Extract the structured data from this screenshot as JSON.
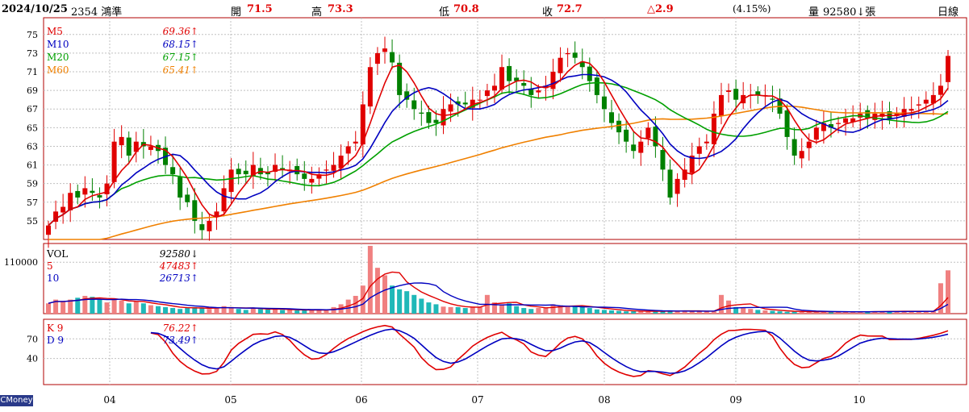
{
  "header": {
    "date": "2024/10/25",
    "stock": "2354 鴻準",
    "open_label": "開",
    "open": "71.5",
    "high_label": "高",
    "high": "73.3",
    "low_label": "低",
    "low": "70.8",
    "close_label": "收",
    "close": "72.7",
    "change": "△2.9",
    "pct": "(4.15%)",
    "volume_label": "量",
    "volume": "92580↓張",
    "period": "日線"
  },
  "brand": "CMoney",
  "colors": {
    "up": "#e00000",
    "down": "#008000",
    "ma5": "#e00000",
    "ma10": "#0000c0",
    "ma20": "#00a000",
    "ma60": "#f08000",
    "vol_up": "#f08080",
    "vol_down": "#20b8b8",
    "grid": "#c0c0c0"
  },
  "chart_data": [
    {
      "type": "candlestick",
      "panel": "price",
      "y_ticks": [
        55,
        57,
        59,
        61,
        63,
        65,
        67,
        69,
        71,
        73,
        75
      ],
      "ylim": [
        53,
        76.8
      ],
      "x_tick_labels": [
        "04",
        "05",
        "06",
        "07",
        "08",
        "09",
        "10"
      ],
      "legend": [
        {
          "name": "M5",
          "value": "69.36",
          "arrow": "↑",
          "color": "#e00000"
        },
        {
          "name": "M10",
          "value": "68.15",
          "arrow": "↑",
          "color": "#0000c0"
        },
        {
          "name": "M20",
          "value": "67.15",
          "arrow": "↑",
          "color": "#00a000"
        },
        {
          "name": "M60",
          "value": "65.41",
          "arrow": "↑",
          "color": "#f08000"
        }
      ],
      "close_series": [
        54.5,
        56.0,
        56.5,
        58.0,
        57.5,
        58.5,
        58.0,
        57.5,
        59.0,
        63.5,
        64.0,
        62.0,
        63.5,
        63.0,
        63.0,
        62.5,
        61.0,
        60.0,
        57.5,
        57.0,
        55.0,
        54.0,
        55.0,
        56.0,
        58.5,
        60.5,
        60.0,
        60.0,
        61.0,
        60.0,
        60.0,
        61.0,
        60.5,
        60.5,
        60.0,
        59.5,
        59.5,
        60.0,
        60.5,
        61.0,
        62.0,
        63.0,
        63.5,
        67.5,
        71.5,
        73.0,
        73.5,
        72.0,
        68.5,
        68.0,
        67.0,
        66.5,
        65.5,
        65.5,
        67.0,
        67.5,
        67.5,
        67.5,
        68.0,
        68.0,
        69.0,
        69.5,
        71.5,
        70.0,
        70.0,
        69.5,
        68.5,
        69.0,
        69.5,
        71.0,
        72.5,
        73.0,
        72.5,
        71.5,
        70.0,
        68.5,
        67.0,
        65.5,
        64.5,
        63.5,
        62.5,
        63.5,
        65.0,
        63.0,
        60.5,
        57.5,
        59.5,
        60.5,
        62.0,
        63.0,
        63.5,
        66.5,
        68.5,
        69.0,
        68.0,
        68.5,
        68.5,
        68.5,
        68.5,
        68.0,
        66.5,
        64.0,
        62.0,
        62.5,
        63.5,
        65.0,
        65.5,
        65.0,
        65.5,
        66.0,
        66.0,
        66.5,
        66.0,
        66.5,
        66.5,
        66.0,
        66.5,
        67.0,
        67.0,
        67.5,
        68.0,
        68.5,
        69.5,
        72.7
      ],
      "ma5_last": 69.36,
      "ma10_last": 68.15,
      "ma20_last": 67.15,
      "ma60_last": 65.41
    },
    {
      "type": "bar",
      "panel": "volume",
      "y_ticks": [
        110000
      ],
      "legend": [
        {
          "name": "VOL",
          "value": "92580",
          "arrow": "↓",
          "color": "#000000"
        },
        {
          "name": "5",
          "value": "47483",
          "arrow": "↑",
          "color": "#e00000"
        },
        {
          "name": "10",
          "value": "26713",
          "arrow": "↑",
          "color": "#0000c0"
        }
      ],
      "values": [
        22000,
        30000,
        26000,
        30000,
        34000,
        38000,
        36000,
        30000,
        24000,
        32000,
        28000,
        22000,
        26000,
        22000,
        18000,
        16000,
        14000,
        12000,
        10000,
        12000,
        14000,
        12000,
        10000,
        12000,
        16000,
        14000,
        10000,
        8000,
        12000,
        10000,
        9000,
        9000,
        8000,
        8000,
        7000,
        8000,
        7000,
        8000,
        9000,
        14000,
        20000,
        30000,
        38000,
        60000,
        145000,
        98000,
        82000,
        60000,
        52000,
        48000,
        40000,
        32000,
        24000,
        20000,
        15000,
        14000,
        14000,
        12000,
        15000,
        14000,
        40000,
        24000,
        19000,
        22000,
        16000,
        12000,
        10000,
        12000,
        12000,
        20000,
        18000,
        17000,
        16000,
        14000,
        12000,
        9000,
        8000,
        7000,
        6000,
        5000,
        5000,
        5000,
        5000,
        5000,
        5000,
        7000,
        6000,
        6000,
        5000,
        5000,
        5000,
        6000,
        40000,
        28000,
        14000,
        12000,
        10000,
        8000,
        7000,
        6000,
        5000,
        4000,
        4000,
        4000,
        4000,
        4000,
        4000,
        4000,
        4000,
        4000,
        4000,
        4000,
        4000,
        5000,
        5000,
        5000,
        5000,
        5000,
        5000,
        5000,
        5000,
        5000,
        65000,
        92580
      ],
      "vol_max": 150000
    },
    {
      "type": "line",
      "panel": "kd",
      "y_ticks": [
        40,
        70
      ],
      "ylim": [
        0,
        100
      ],
      "legend": [
        {
          "name": "K 9",
          "value": "76.22",
          "arrow": "↑",
          "color": "#e00000"
        },
        {
          "name": "D 9",
          "value": "73.49",
          "arrow": "↑",
          "color": "#0000c0"
        }
      ]
    }
  ]
}
